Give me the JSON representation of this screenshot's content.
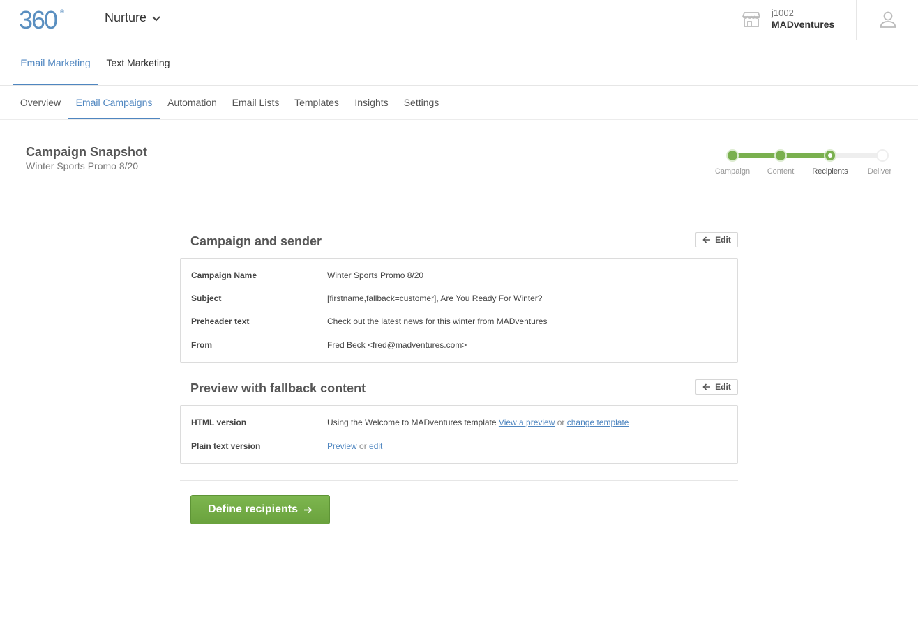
{
  "brand": {
    "logo_text": "360",
    "logo_mark": "®",
    "accent": "#4f86c0",
    "success": "#7ab04f"
  },
  "header": {
    "app_name": "Nurture",
    "account_id": "j1002",
    "account_name": "MADventures"
  },
  "nav_primary": [
    {
      "label": "Email Marketing",
      "active": true
    },
    {
      "label": "Text Marketing",
      "active": false
    }
  ],
  "nav_secondary": [
    {
      "label": "Overview",
      "active": false
    },
    {
      "label": "Email Campaigns",
      "active": true
    },
    {
      "label": "Automation",
      "active": false
    },
    {
      "label": "Email Lists",
      "active": false
    },
    {
      "label": "Templates",
      "active": false
    },
    {
      "label": "Insights",
      "active": false
    },
    {
      "label": "Settings",
      "active": false
    }
  ],
  "snapshot": {
    "title": "Campaign Snapshot",
    "subtitle": "Winter Sports Promo 8/20"
  },
  "stepper": {
    "steps": [
      "Campaign",
      "Content",
      "Recipients",
      "Deliver"
    ],
    "current_index": 2
  },
  "campaign_section": {
    "title": "Campaign and sender",
    "edit_label": "Edit",
    "rows": [
      {
        "label": "Campaign Name",
        "value": "Winter Sports Promo 8/20"
      },
      {
        "label": "Subject",
        "value": "[firstname,fallback=customer], Are You Ready For Winter?"
      },
      {
        "label": "Preheader text",
        "value": "Check out the latest news for this winter from MADventures"
      },
      {
        "label": "From",
        "value": "Fred Beck <fred@madventures.com>"
      }
    ]
  },
  "preview_section": {
    "title": "Preview with fallback content",
    "edit_label": "Edit",
    "html_label": "HTML version",
    "html_text": "Using the Welcome to MADventures template",
    "html_link_preview": "View a preview",
    "or": "or",
    "html_link_change": "change template",
    "plain_label": "Plain text version",
    "plain_link_preview": "Preview",
    "plain_link_edit": "edit"
  },
  "cta": {
    "label": "Define recipients"
  }
}
